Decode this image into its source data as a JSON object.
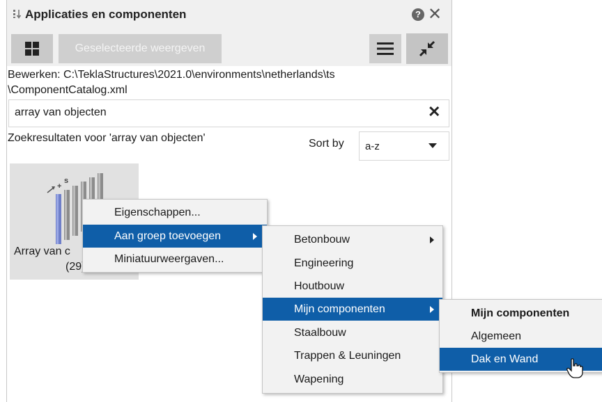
{
  "window": {
    "title": "Applicaties en componenten",
    "help_glyph": "?",
    "close_glyph": "✕"
  },
  "toolbar": {
    "selected_view_label": "Geselecteerde weergeven"
  },
  "path": {
    "line1": "Bewerken:  C:\\TeklaStructures\\2021.0\\environments\\netherlands\\ts",
    "line2": "\\ComponentCatalog.xml"
  },
  "search": {
    "value": "array van objecten",
    "clear_glyph": "✕"
  },
  "results": {
    "label": "Zoekresultaten voor 'array van objecten'",
    "sort_label": "Sort by",
    "sort_value": "a-z"
  },
  "tile": {
    "name_visible": "Array van c",
    "count_visible": "(29)"
  },
  "context_menu": {
    "items": [
      {
        "label": "Eigenschappen..."
      },
      {
        "label": "Aan groep toevoegen",
        "selected": true,
        "submenu": true
      },
      {
        "label": "Miniatuurweergaven..."
      }
    ]
  },
  "group_submenu": {
    "items": [
      {
        "label": "Betonbouw",
        "submenu": true
      },
      {
        "label": "Engineering"
      },
      {
        "label": "Houtbouw"
      },
      {
        "label": "Mijn componenten",
        "selected": true,
        "submenu": true
      },
      {
        "label": "Staalbouw"
      },
      {
        "label": "Trappen & Leuningen"
      },
      {
        "label": "Wapening"
      }
    ]
  },
  "components_submenu": {
    "items": [
      {
        "label": "Mijn componenten",
        "bold": true
      },
      {
        "label": "Algemeen"
      },
      {
        "label": "Dak en Wand",
        "selected": true
      }
    ]
  },
  "colors": {
    "selection": "#0f5ea8",
    "toolbar_bg": "#f0f0f0",
    "tile_bg": "#e1e1e1"
  }
}
